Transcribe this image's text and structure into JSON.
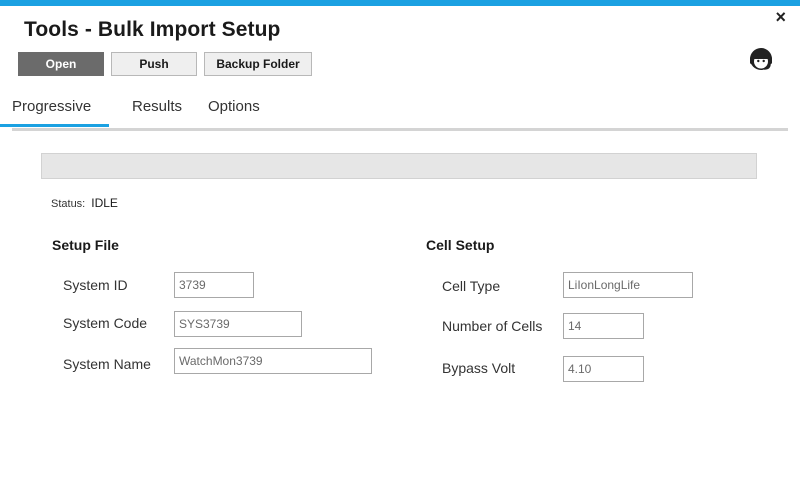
{
  "window": {
    "title": "Tools - Bulk Import Setup",
    "close_label": "×"
  },
  "toolbar": {
    "open_label": "Open",
    "push_label": "Push",
    "backup_label": "Backup Folder"
  },
  "tabs": [
    {
      "label": "Progressive",
      "active": true
    },
    {
      "label": "Results",
      "active": false
    },
    {
      "label": "Options",
      "active": false
    }
  ],
  "progress": {
    "fraction": 0
  },
  "status": {
    "label": "Status:",
    "value": "IDLE"
  },
  "setup_file": {
    "heading": "Setup File",
    "system_id": {
      "label": "System ID",
      "value": "3739"
    },
    "system_code": {
      "label": "System Code",
      "value": "SYS3739"
    },
    "system_name": {
      "label": "System Name",
      "value": "WatchMon3739"
    }
  },
  "cell_setup": {
    "heading": "Cell Setup",
    "cell_type": {
      "label": "Cell Type",
      "value": "LiIonLongLife"
    },
    "number_of_cells": {
      "label": "Number of Cells",
      "value": "14"
    },
    "bypass_volt": {
      "label": "Bypass Volt",
      "value": "4.10"
    }
  },
  "icons": {
    "support": "headset-support-icon",
    "close": "close-icon"
  },
  "colors": {
    "accent": "#1ba1e2",
    "primary_button": "#6b6b6b",
    "tab_rule": "#d4d4d4"
  }
}
